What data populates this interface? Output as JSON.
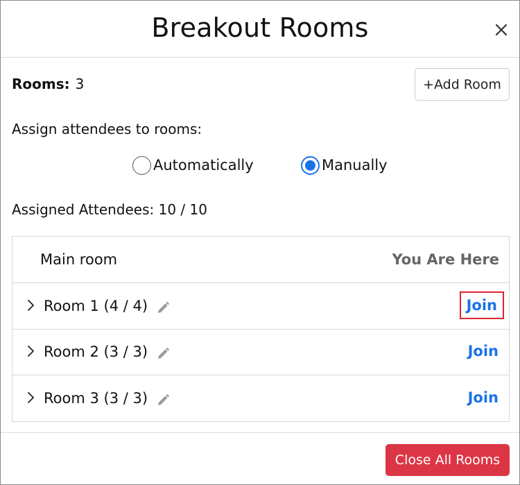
{
  "dialog": {
    "title": "Breakout Rooms",
    "close_icon": "close-icon"
  },
  "rooms": {
    "label": "Rooms:",
    "count": "3",
    "add_room_label": "+Add Room"
  },
  "assign": {
    "label": "Assign attendees to rooms:",
    "options": [
      {
        "label": "Automatically",
        "selected": false
      },
      {
        "label": "Manually",
        "selected": true
      }
    ]
  },
  "assigned": {
    "text": "Assigned Attendees: 10 / 10"
  },
  "table": {
    "main_room": {
      "label": "Main room",
      "status": "You Are Here"
    },
    "rooms": [
      {
        "label": "Room 1 (4 / 4)",
        "action": "Join",
        "highlighted": true
      },
      {
        "label": "Room 2 (3 / 3)",
        "action": "Join",
        "highlighted": false
      },
      {
        "label": "Room 3 (3 / 3)",
        "action": "Join",
        "highlighted": false
      }
    ]
  },
  "footer": {
    "close_all_label": "Close All Rooms"
  },
  "colors": {
    "accent": "#1a73e8",
    "danger": "#dc3545",
    "highlight_border": "#e0242e",
    "muted": "#666666"
  }
}
